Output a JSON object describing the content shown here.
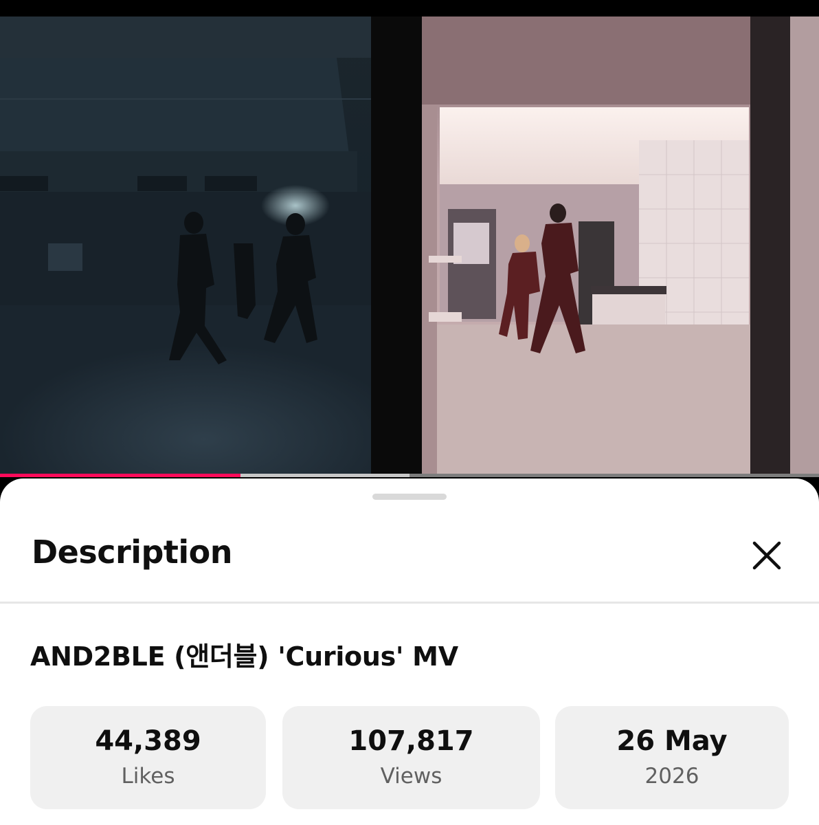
{
  "player": {
    "progress_played": 0.294,
    "progress_buffered": 0.5
  },
  "sheet": {
    "title": "Description",
    "close_icon": "close-icon"
  },
  "video": {
    "title": "AND2BLE (앤더블) 'Curious' MV"
  },
  "stats": [
    {
      "value": "44,389",
      "label": "Likes"
    },
    {
      "value": "107,817",
      "label": "Views"
    },
    {
      "value": "26 May",
      "label": "2026"
    }
  ],
  "colors": {
    "accent": "#ff0a5a",
    "stat_background": "#f0f0f0",
    "secondary_text": "#606060"
  }
}
